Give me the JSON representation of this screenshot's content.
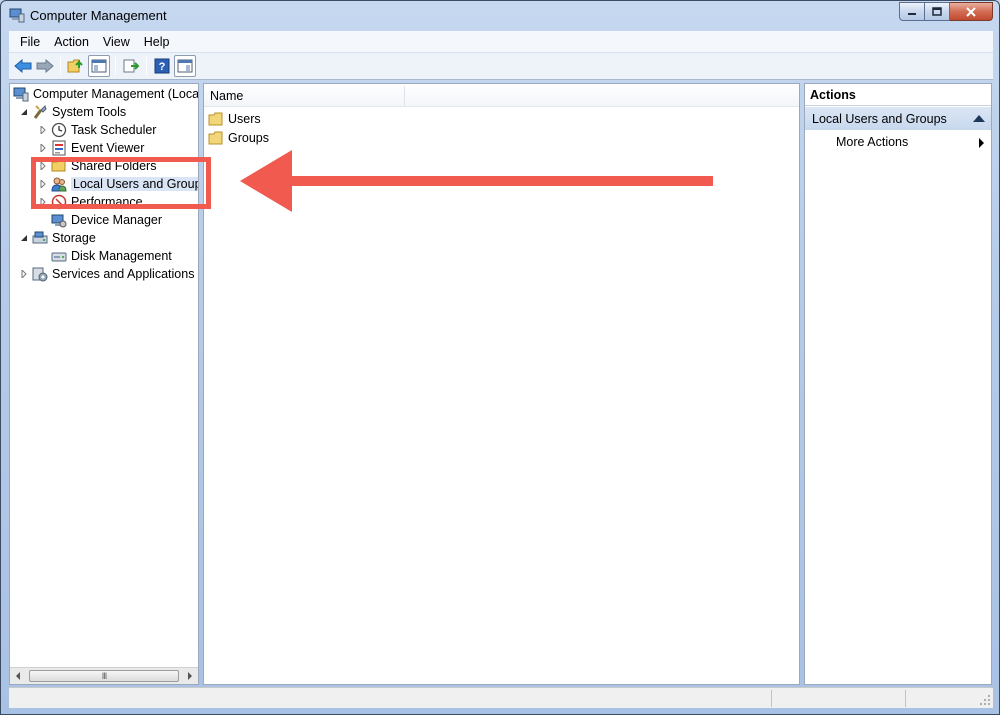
{
  "window": {
    "title": "Computer Management",
    "controls": {
      "minimize": "minimize",
      "maximize": "maximize",
      "close": "close"
    }
  },
  "menu": [
    "File",
    "Action",
    "View",
    "Help"
  ],
  "toolbar": {
    "icons": [
      "back-arrow-icon",
      "forward-arrow-icon",
      "up-folder-icon",
      "show-hide-tree-icon",
      "export-list-icon",
      "help-icon",
      "show-hide-action-pane-icon"
    ]
  },
  "tree": {
    "root": "Computer Management (Local",
    "items": [
      {
        "label": "System Tools",
        "expanded": true
      },
      {
        "label": "Task Scheduler"
      },
      {
        "label": "Event Viewer"
      },
      {
        "label": "Shared Folders"
      },
      {
        "label": "Local Users and Groups",
        "selected": true
      },
      {
        "label": "Performance"
      },
      {
        "label": "Device Manager"
      },
      {
        "label": "Storage",
        "expanded": true
      },
      {
        "label": "Disk Management"
      },
      {
        "label": "Services and Applications"
      }
    ],
    "scroll_grip": "III"
  },
  "list": {
    "columns": [
      "Name"
    ],
    "rows": [
      "Users",
      "Groups"
    ]
  },
  "actions": {
    "header": "Actions",
    "section": "Local Users and Groups",
    "items": [
      "More Actions"
    ]
  },
  "colors": {
    "annotation": "#f15a4e",
    "selection": "#d9e4f5",
    "window_frame": "#b6cbe8"
  }
}
